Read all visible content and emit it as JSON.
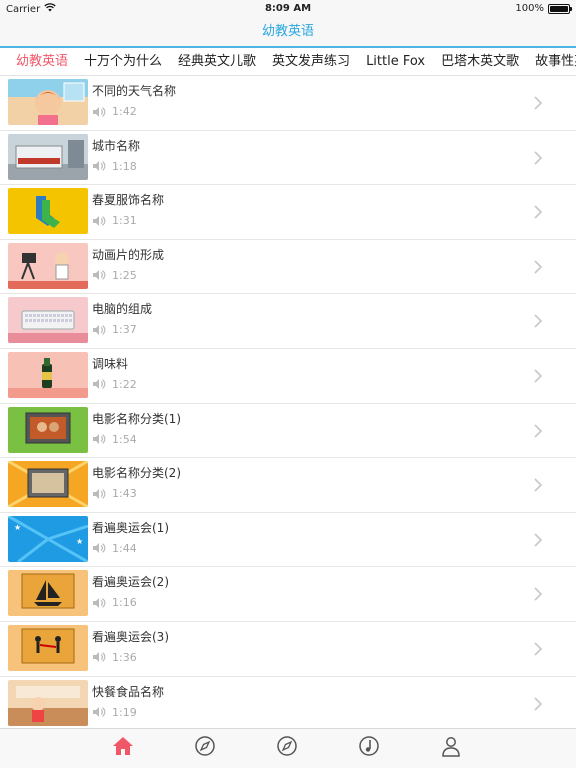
{
  "status": {
    "carrier": "Carrier",
    "time": "8:09 AM",
    "battery": "100%",
    "battery_level": 1.0
  },
  "nav": {
    "title": "幼教英语"
  },
  "tabs": [
    {
      "label": "幼教英语",
      "active": true
    },
    {
      "label": "十万个为什么",
      "active": false
    },
    {
      "label": "经典英文儿歌",
      "active": false
    },
    {
      "label": "英文发声练习",
      "active": false
    },
    {
      "label": "Little Fox",
      "active": false
    },
    {
      "label": "巴塔木英文歌",
      "active": false
    },
    {
      "label": "故事性英文",
      "active": false
    }
  ],
  "items": [
    {
      "title": "不同的天气名称",
      "duration": "1:42",
      "thumb": "weather"
    },
    {
      "title": "城市名称",
      "duration": "1:18",
      "thumb": "city"
    },
    {
      "title": "春夏服饰名称",
      "duration": "1:31",
      "thumb": "clothes"
    },
    {
      "title": "动画片的形成",
      "duration": "1:25",
      "thumb": "animation"
    },
    {
      "title": "电脑的组成",
      "duration": "1:37",
      "thumb": "computer"
    },
    {
      "title": "调味料",
      "duration": "1:22",
      "thumb": "seasoning"
    },
    {
      "title": "电影名称分类(1)",
      "duration": "1:54",
      "thumb": "movie1"
    },
    {
      "title": "电影名称分类(2)",
      "duration": "1:43",
      "thumb": "movie2"
    },
    {
      "title": "看遍奥运会(1)",
      "duration": "1:44",
      "thumb": "olympic1"
    },
    {
      "title": "看遍奥运会(2)",
      "duration": "1:16",
      "thumb": "olympic2"
    },
    {
      "title": "看遍奥运会(3)",
      "duration": "1:36",
      "thumb": "olympic3"
    },
    {
      "title": "快餐食品名称",
      "duration": "1:19",
      "thumb": "fastfood"
    }
  ],
  "tabbar": [
    {
      "icon": "home-icon",
      "active": true
    },
    {
      "icon": "compass-icon",
      "active": false
    },
    {
      "icon": "compass-icon",
      "active": false
    },
    {
      "icon": "music-note-icon",
      "active": false
    },
    {
      "icon": "person-icon",
      "active": false
    }
  ],
  "colors": {
    "accent_blue": "#29a8e0",
    "accent_red": "#f0586a",
    "separator": "#e6e6e6"
  }
}
